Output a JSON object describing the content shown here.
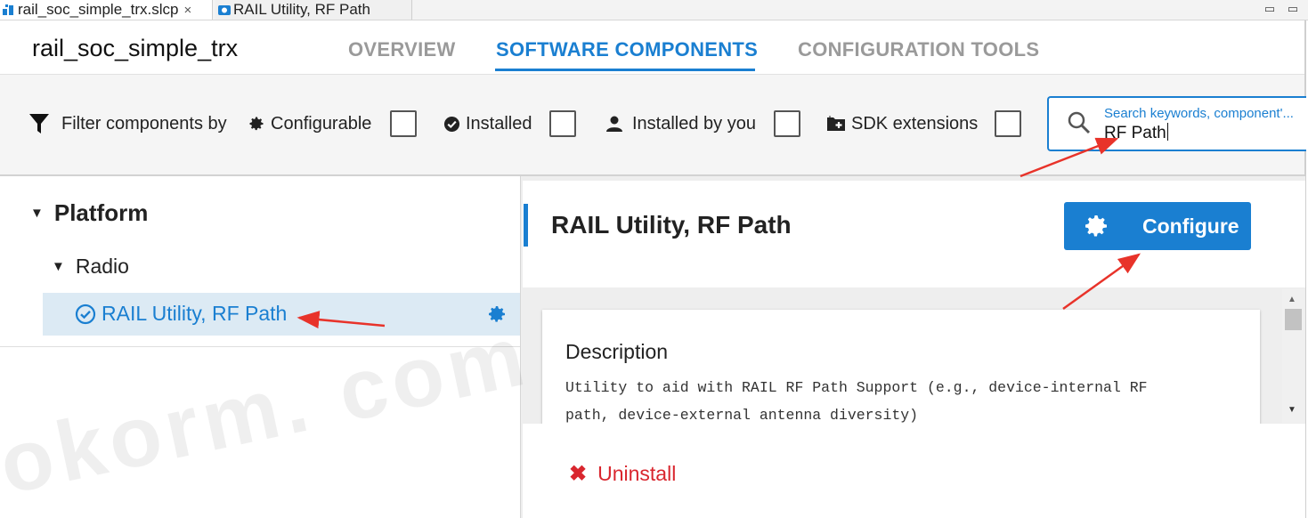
{
  "editor_tabs": [
    {
      "label": "rail_soc_simple_trx.slcp",
      "close": "×"
    },
    {
      "label": "RAIL Utility, RF Path"
    }
  ],
  "window_controls": {
    "minimize": "▭",
    "maximize": "▭"
  },
  "header": {
    "project_title": "rail_soc_simple_trx",
    "tabs": [
      {
        "label": "OVERVIEW",
        "active": false
      },
      {
        "label": "SOFTWARE COMPONENTS",
        "active": true
      },
      {
        "label": "CONFIGURATION TOOLS",
        "active": false
      }
    ]
  },
  "filter": {
    "label": "Filter components by",
    "options": [
      {
        "label": "Configurable",
        "icon": "gear-icon",
        "checked": false
      },
      {
        "label": "Installed",
        "icon": "check-circle-icon",
        "checked": false
      },
      {
        "label": "Installed by you",
        "icon": "person-icon",
        "checked": false
      },
      {
        "label": "SDK extensions",
        "icon": "folder-plus-icon",
        "checked": false
      }
    ],
    "search": {
      "placeholder": "Search keywords, component'...",
      "value": "RF Path"
    }
  },
  "tree": {
    "category": "Platform",
    "subcategory": "Radio",
    "component": "RAIL Utility, RF Path"
  },
  "detail": {
    "title": "RAIL Utility, RF Path",
    "configure_label": "Configure",
    "description_heading": "Description",
    "description_lines": [
      "Utility to aid with RAIL RF Path Support (e.g., device-internal RF",
      "path, device-external antenna diversity)"
    ],
    "uninstall_label": "Uninstall"
  },
  "watermark": "okorm. com",
  "colors": {
    "accent": "#1a7fd1",
    "danger": "#d9262e",
    "selected_row": "#dceaf4",
    "annotation": "#e8332a"
  }
}
